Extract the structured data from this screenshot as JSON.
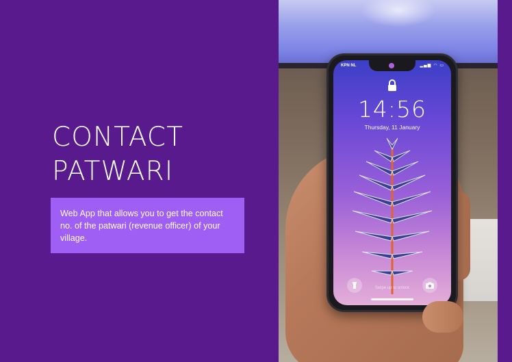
{
  "hero": {
    "title": "CONTACT\nPATWARI",
    "description": "Web App that allows you to get the contact no. of the patwari (revenue officer) of your village."
  },
  "phone": {
    "carrier": "KPN NL",
    "status_icons": "▂▄▆ ◠ ▭",
    "time": "14:56",
    "date": "Thursday, 11 January",
    "swipe_hint": "Swipe up to unlock"
  },
  "colors": {
    "background": "#581a8c",
    "accent_box": "#9f5ff5",
    "title_text": "#ffffff"
  },
  "icons": [
    "lock-icon",
    "flashlight-icon",
    "camera-icon"
  ]
}
